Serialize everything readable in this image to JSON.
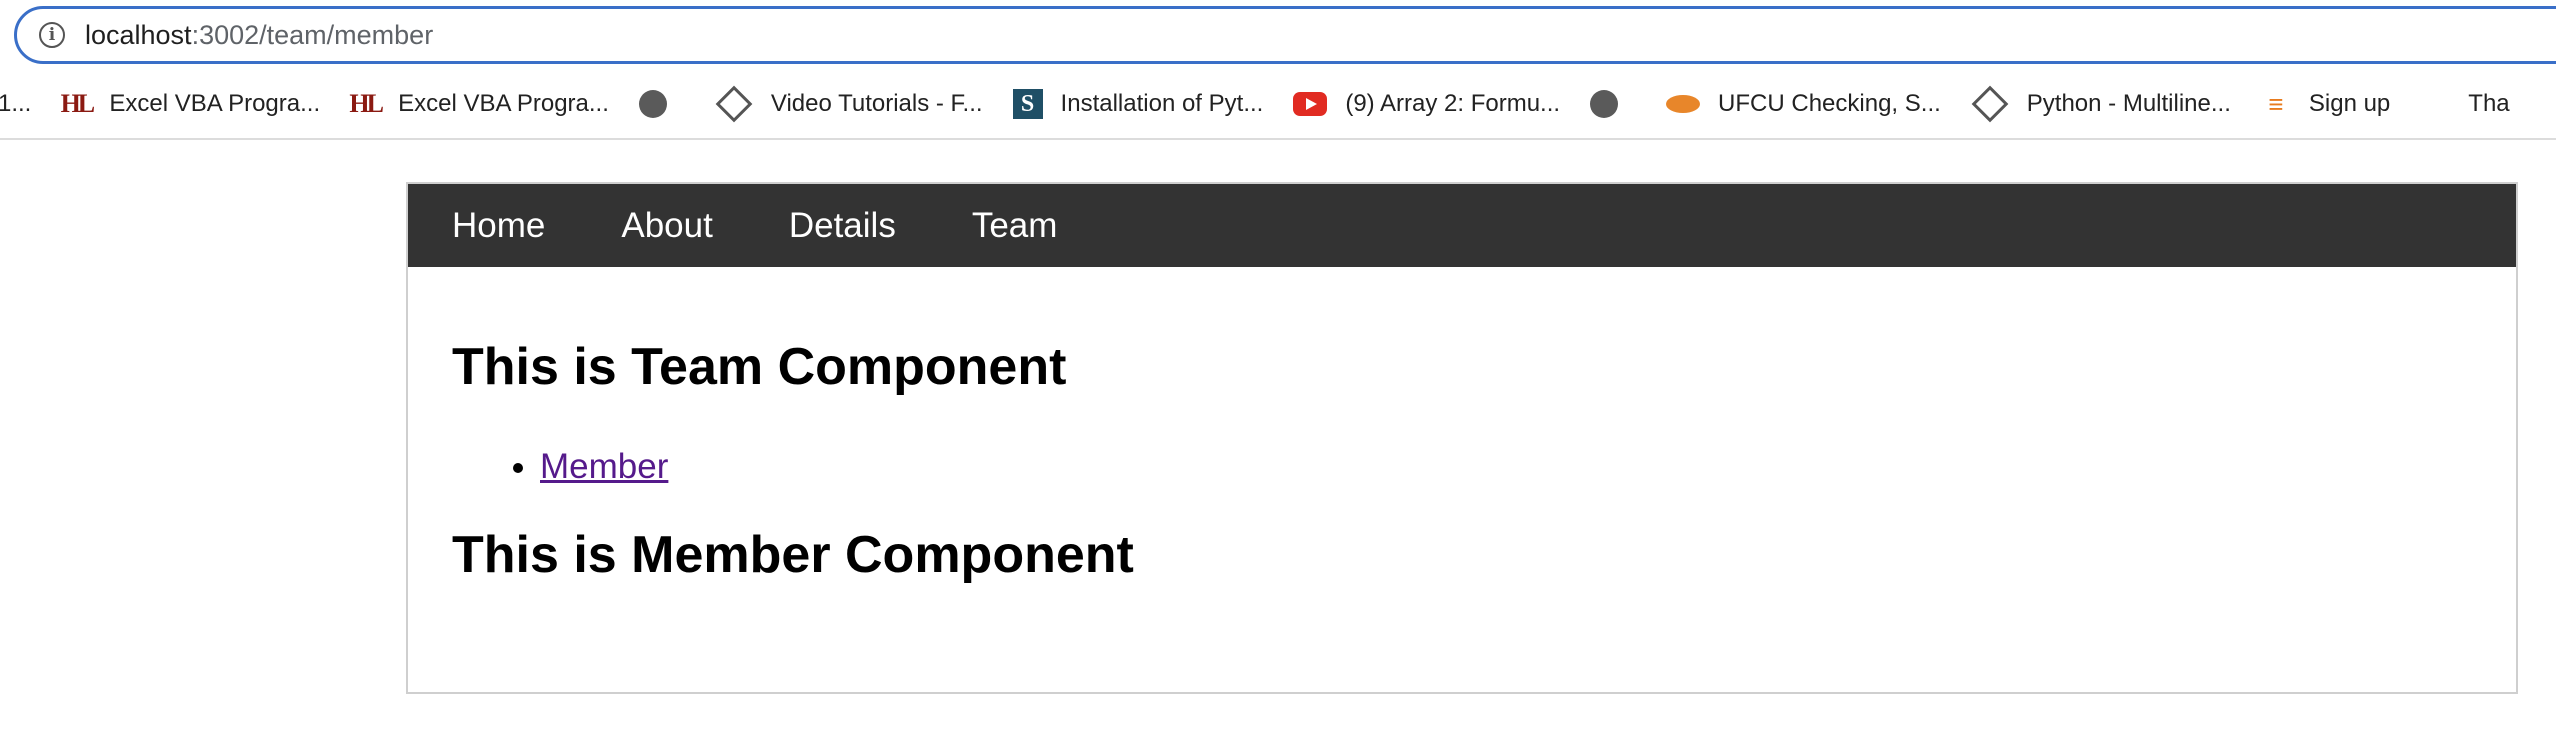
{
  "browser": {
    "url_host": "localhost",
    "url_path": ":3002/team/member",
    "bookmarks": [
      {
        "icon": "partial",
        "label": "1..."
      },
      {
        "icon": "hl-icon",
        "label": "Excel VBA Progra..."
      },
      {
        "icon": "hl-icon",
        "label": "Excel VBA Progra..."
      },
      {
        "icon": "globe-icon",
        "label": ""
      },
      {
        "icon": "diamond-icon",
        "label": "Video Tutorials - F..."
      },
      {
        "icon": "s-icon",
        "label": "Installation of Pyt..."
      },
      {
        "icon": "youtube-icon",
        "label": "(9) Array 2: Formu..."
      },
      {
        "icon": "globe-icon",
        "label": ""
      },
      {
        "icon": "ufcu-icon",
        "label": "UFCU Checking, S..."
      },
      {
        "icon": "diamond-icon",
        "label": "Python - Multiline..."
      },
      {
        "icon": "stackoverflow-icon",
        "label": "Sign up"
      },
      {
        "icon": "partial",
        "label": "Tha"
      }
    ]
  },
  "nav": {
    "items": [
      "Home",
      "About",
      "Details",
      "Team"
    ]
  },
  "main": {
    "team_heading": "This is Team Component",
    "sublinks": [
      "Member"
    ],
    "member_heading": "This is Member Component"
  },
  "colors": {
    "nav_bg": "#333333",
    "link_visited": "#551a8b",
    "address_border": "#3a6fc8"
  }
}
